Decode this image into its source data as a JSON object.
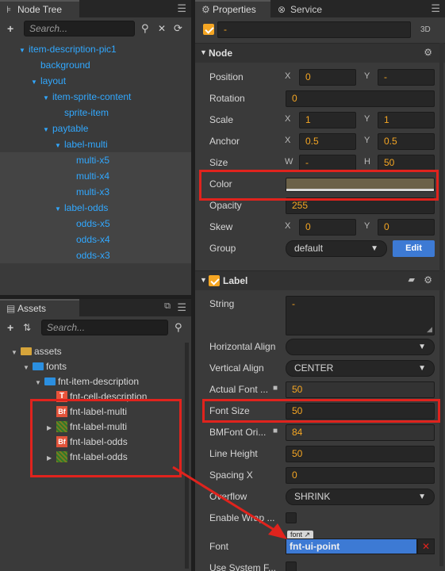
{
  "node_tree": {
    "tab_label": "Node Tree",
    "search_placeholder": "Search...",
    "items": [
      {
        "label": "item-description-pic1",
        "indent": 0,
        "arrow": true,
        "alt": false
      },
      {
        "label": "background",
        "indent": 1,
        "arrow": false,
        "alt": false
      },
      {
        "label": "layout",
        "indent": 1,
        "arrow": true,
        "alt": false
      },
      {
        "label": "item-sprite-content",
        "indent": 2,
        "arrow": true,
        "alt": false
      },
      {
        "label": "sprite-item",
        "indent": 3,
        "arrow": false,
        "alt": false
      },
      {
        "label": "paytable",
        "indent": 2,
        "arrow": true,
        "alt": false
      },
      {
        "label": "label-multi",
        "indent": 3,
        "arrow": true,
        "alt": false
      },
      {
        "label": "multi-x5",
        "indent": 4,
        "arrow": false,
        "alt": true
      },
      {
        "label": "multi-x4",
        "indent": 4,
        "arrow": false,
        "alt": true
      },
      {
        "label": "multi-x3",
        "indent": 4,
        "arrow": false,
        "alt": true
      },
      {
        "label": "label-odds",
        "indent": 3,
        "arrow": true,
        "alt": true
      },
      {
        "label": "odds-x5",
        "indent": 4,
        "arrow": false,
        "alt": true
      },
      {
        "label": "odds-x4",
        "indent": 4,
        "arrow": false,
        "alt": true
      },
      {
        "label": "odds-x3",
        "indent": 4,
        "arrow": false,
        "alt": true
      }
    ]
  },
  "assets": {
    "tab_label": "Assets",
    "search_placeholder": "Search...",
    "items": [
      {
        "label": "assets",
        "icon": "folder-gold",
        "indent": 0,
        "arrow": "down"
      },
      {
        "label": "fonts",
        "icon": "folder",
        "indent": 1,
        "arrow": "down"
      },
      {
        "label": "fnt-item-description",
        "icon": "folder",
        "indent": 2,
        "arrow": "down"
      },
      {
        "label": "fnt-cell-description",
        "icon": "ttf",
        "indent": 3,
        "arrow": ""
      },
      {
        "label": "fnt-label-multi",
        "icon": "bf",
        "indent": 3,
        "arrow": ""
      },
      {
        "label": "fnt-label-multi",
        "icon": "atlas",
        "indent": 3,
        "arrow": "right"
      },
      {
        "label": "fnt-label-odds",
        "icon": "bf",
        "indent": 3,
        "arrow": ""
      },
      {
        "label": "fnt-label-odds",
        "icon": "atlas",
        "indent": 3,
        "arrow": "right"
      }
    ]
  },
  "properties": {
    "tab_label": "Properties",
    "service_tab_label": "Service",
    "node_name": "-",
    "badge_3d": "3D",
    "node_section": "Node",
    "label_section": "Label",
    "position": {
      "label": "Position",
      "x": "0",
      "y": "-"
    },
    "rotation": {
      "label": "Rotation",
      "value": "0"
    },
    "scale": {
      "label": "Scale",
      "x": "1",
      "y": "1"
    },
    "anchor": {
      "label": "Anchor",
      "x": "0.5",
      "y": "0.5"
    },
    "size": {
      "label": "Size",
      "w": "-",
      "h": "50"
    },
    "color": {
      "label": "Color",
      "swatch": "#6b6148"
    },
    "opacity": {
      "label": "Opacity",
      "value": "255"
    },
    "skew": {
      "label": "Skew",
      "x": "0",
      "y": "0"
    },
    "group": {
      "label": "Group",
      "value": "default",
      "edit_label": "Edit"
    },
    "string": {
      "label": "String",
      "value": "-"
    },
    "horizontal_align": {
      "label": "Horizontal Align",
      "value": ""
    },
    "vertical_align": {
      "label": "Vertical Align",
      "value": "CENTER"
    },
    "actual_font_size": {
      "label": "Actual Font ...",
      "value": "50"
    },
    "font_size": {
      "label": "Font Size",
      "value": "50"
    },
    "bmfont_original_size": {
      "label": "BMFont Ori...",
      "value": "84"
    },
    "line_height": {
      "label": "Line Height",
      "value": "50"
    },
    "spacing_x": {
      "label": "Spacing X",
      "value": "0"
    },
    "overflow": {
      "label": "Overflow",
      "value": "SHRINK"
    },
    "enable_wrap": {
      "label": "Enable Wrap ..."
    },
    "font": {
      "label": "Font",
      "tag": "font",
      "value": "fnt-ui-point"
    },
    "use_system_font": {
      "label": "Use System F..."
    }
  },
  "axis": {
    "x": "X",
    "y": "Y",
    "w": "W",
    "h": "H"
  },
  "colors": {
    "highlight": "#e0231d",
    "accent": "#f5a623",
    "tree_blue": "#31a8ff",
    "edit_blue": "#3d7ad4"
  }
}
